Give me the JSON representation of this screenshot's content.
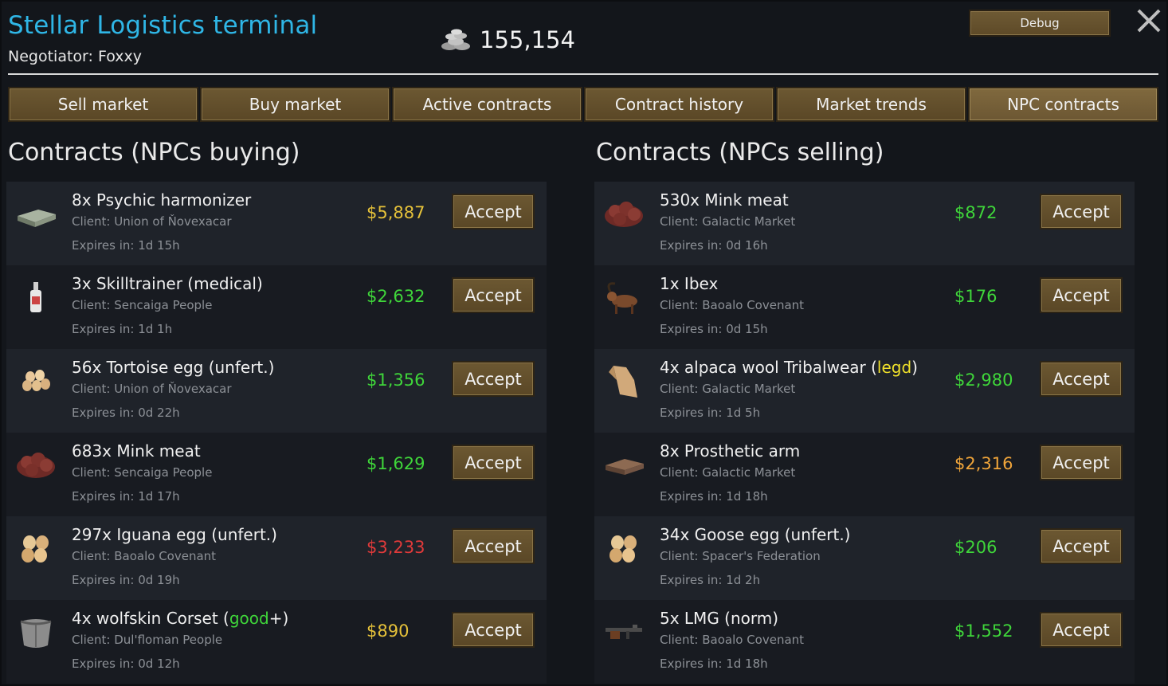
{
  "window": {
    "title": "Stellar Logistics terminal",
    "negotiator": "Negotiator: Foxxy",
    "silver_amount": "155,154",
    "silver_icon": "silver-coins-icon",
    "debug_label": "Debug",
    "close_icon": "close-icon"
  },
  "tabs": [
    {
      "label": "Sell market",
      "active": false
    },
    {
      "label": "Buy market",
      "active": false
    },
    {
      "label": "Active contracts",
      "active": false
    },
    {
      "label": "Contract history",
      "active": false
    },
    {
      "label": "Market trends",
      "active": false
    },
    {
      "label": "NPC contracts",
      "active": true
    }
  ],
  "colors": {
    "title": "#2fb6e6",
    "price_green": "#3fd63a",
    "price_yellow": "#e6c23a",
    "price_orange": "#f0a53a",
    "price_red": "#e03a3a",
    "quality_good": "#3fd63a",
    "quality_legendary": "#f0e12a"
  },
  "buying": {
    "title": "Contracts (NPCs buying)",
    "rows": [
      {
        "name": "8x Psychic harmonizer",
        "quality": "",
        "suffix": "",
        "client": "Client: Union of Ňovexacar",
        "expires": "Expires in: 1d 15h",
        "price": "$5,887",
        "price_color": "#e6c23a",
        "icon": "psychic-harmonizer-icon",
        "accept": "Accept"
      },
      {
        "name": "3x Skilltrainer (medical)",
        "quality": "",
        "suffix": "",
        "client": "Client: Sencaiga People",
        "expires": "Expires in: 1d 1h",
        "price": "$2,632",
        "price_color": "#3fd63a",
        "icon": "skilltrainer-icon",
        "accept": "Accept"
      },
      {
        "name": "56x Tortoise egg (unfert.)",
        "quality": "",
        "suffix": "",
        "client": "Client: Union of Ňovexacar",
        "expires": "Expires in: 0d 22h",
        "price": "$1,356",
        "price_color": "#3fd63a",
        "icon": "egg-icon",
        "accept": "Accept"
      },
      {
        "name": "683x Mink meat",
        "quality": "",
        "suffix": "",
        "client": "Client: Sencaiga People",
        "expires": "Expires in: 1d 17h",
        "price": "$1,629",
        "price_color": "#3fd63a",
        "icon": "meat-icon",
        "accept": "Accept"
      },
      {
        "name": "297x Iguana egg (unfert.)",
        "quality": "",
        "suffix": "",
        "client": "Client: Baoalo Covenant",
        "expires": "Expires in: 0d 19h",
        "price": "$3,233",
        "price_color": "#e03a3a",
        "icon": "large-egg-icon",
        "accept": "Accept"
      },
      {
        "name": "4x wolfskin Corset (",
        "quality": "good",
        "suffix": "+)",
        "client": "Client: Dul'floman People",
        "expires": "Expires in: 0d 12h",
        "price": "$890",
        "price_color": "#e6c23a",
        "icon": "corset-icon",
        "accept": "Accept"
      }
    ]
  },
  "selling": {
    "title": "Contracts (NPCs selling)",
    "rows": [
      {
        "name": "530x Mink meat",
        "quality": "",
        "suffix": "",
        "client": "Client: Galactic Market",
        "expires": "Expires in: 0d 16h",
        "price": "$872",
        "price_color": "#3fd63a",
        "icon": "meat-icon",
        "accept": "Accept"
      },
      {
        "name": "1x Ibex",
        "quality": "",
        "suffix": "",
        "client": "Client: Baoalo Covenant",
        "expires": "Expires in: 0d 15h",
        "price": "$176",
        "price_color": "#3fd63a",
        "icon": "ibex-icon",
        "accept": "Accept"
      },
      {
        "name": "4x alpaca wool Tribalwear (",
        "quality": "legd",
        "suffix": ")",
        "client": "Client: Galactic Market",
        "expires": "Expires in: 1d 5h",
        "price": "$2,980",
        "price_color": "#3fd63a",
        "icon": "tribalwear-icon",
        "accept": "Accept"
      },
      {
        "name": "8x Prosthetic arm",
        "quality": "",
        "suffix": "",
        "client": "Client: Galactic Market",
        "expires": "Expires in: 1d 18h",
        "price": "$2,316",
        "price_color": "#f0a53a",
        "icon": "prosthetic-arm-icon",
        "accept": "Accept"
      },
      {
        "name": "34x Goose egg (unfert.)",
        "quality": "",
        "suffix": "",
        "client": "Client: Spacer's Federation",
        "expires": "Expires in: 1d 2h",
        "price": "$206",
        "price_color": "#3fd63a",
        "icon": "large-egg-icon",
        "accept": "Accept"
      },
      {
        "name": "5x LMG (norm)",
        "quality": "",
        "suffix": "",
        "client": "Client: Baoalo Covenant",
        "expires": "Expires in: 1d 18h",
        "price": "$1,552",
        "price_color": "#3fd63a",
        "icon": "lmg-icon",
        "accept": "Accept"
      }
    ]
  }
}
